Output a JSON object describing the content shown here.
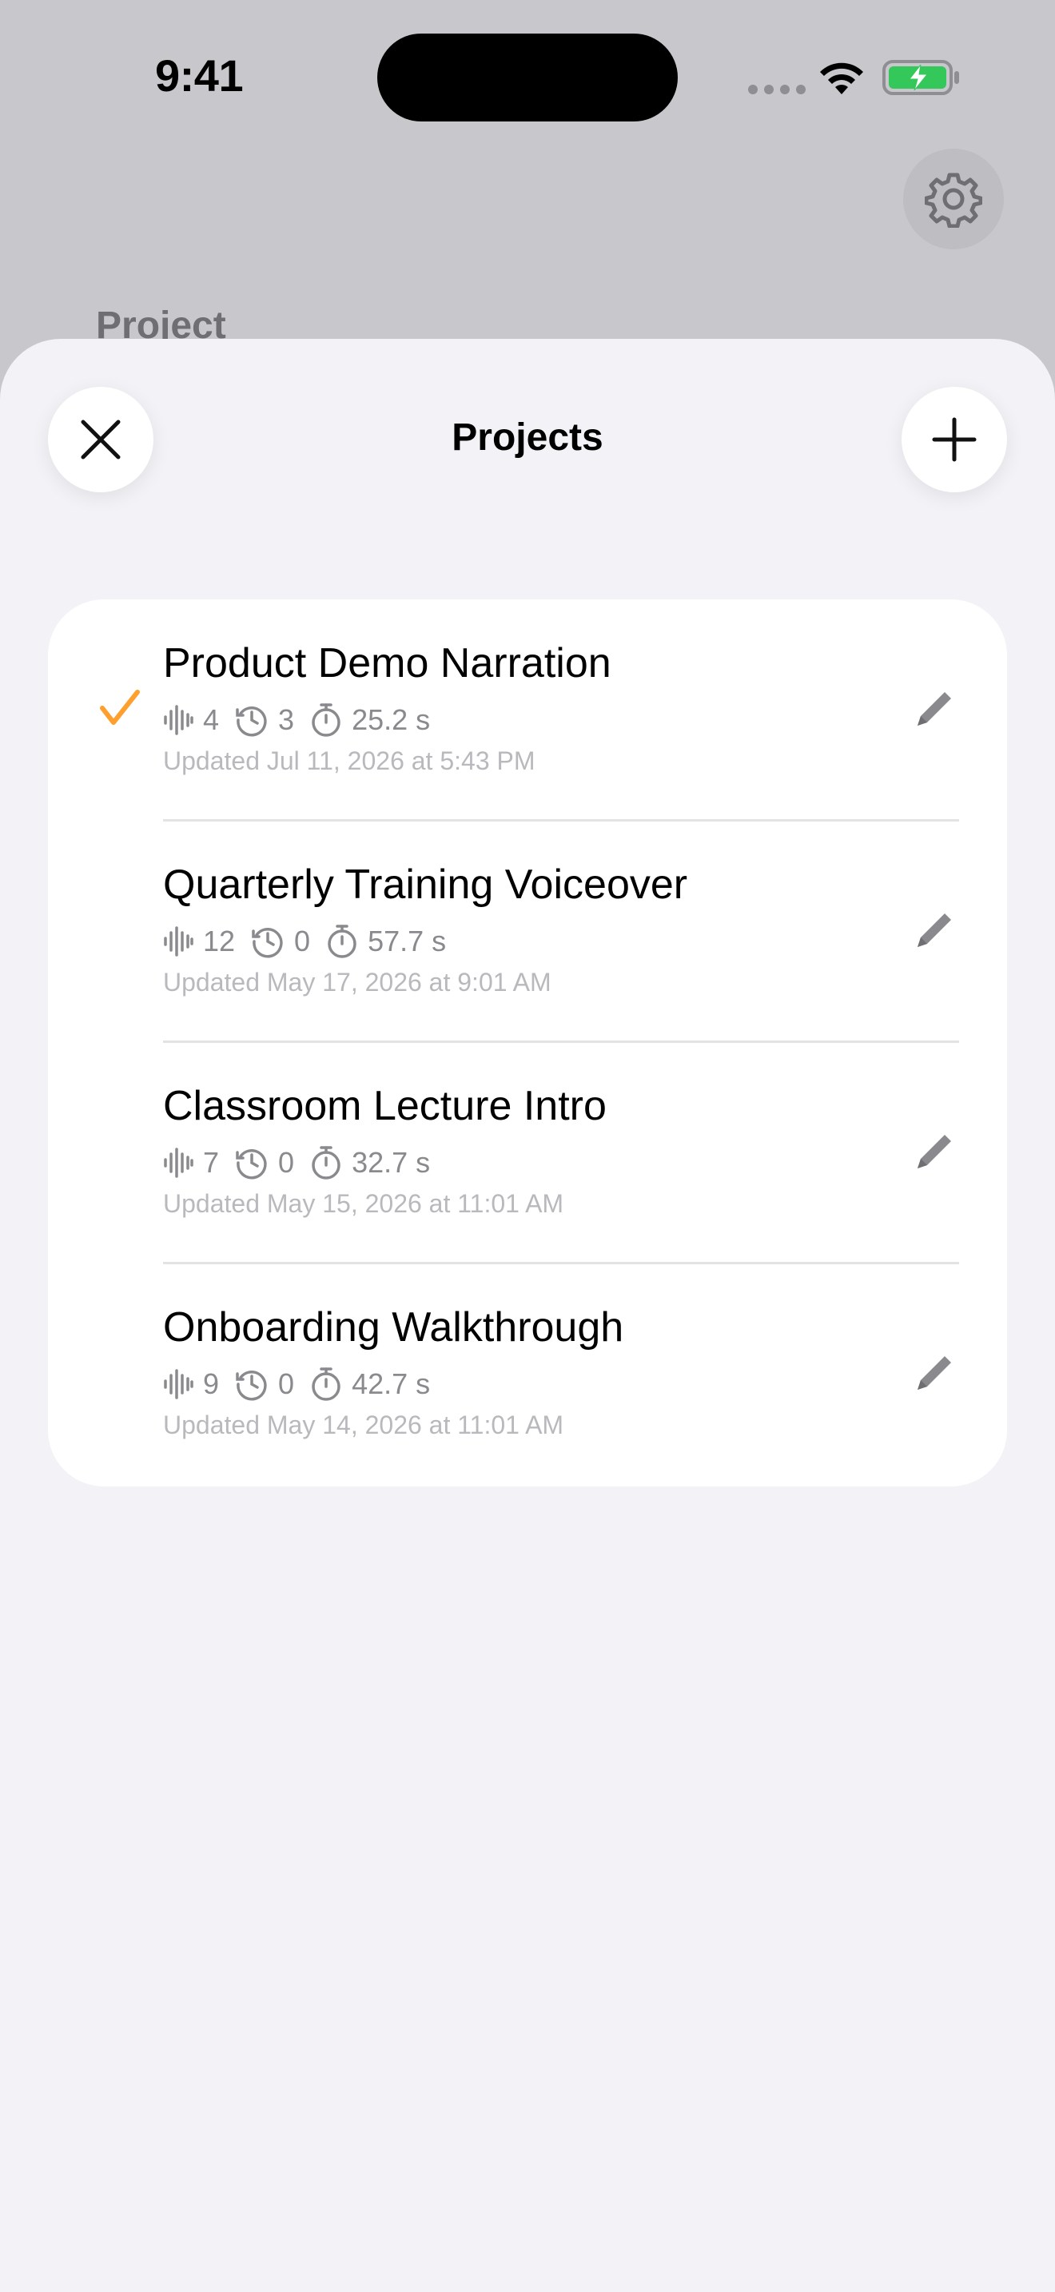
{
  "status_bar": {
    "time": "9:41"
  },
  "background": {
    "title": "Project"
  },
  "sheet": {
    "title": "Projects",
    "accent_color": "#ff9f2e"
  },
  "projects": [
    {
      "name": "Product Demo Narration",
      "clips": "4",
      "versions": "3",
      "duration": "25.2 s",
      "updated": "Updated Jul 11, 2026 at 5:43 PM",
      "selected": true
    },
    {
      "name": "Quarterly Training Voiceover",
      "clips": "12",
      "versions": "0",
      "duration": "57.7 s",
      "updated": "Updated May 17, 2026 at 9:01 AM",
      "selected": false
    },
    {
      "name": "Classroom Lecture Intro",
      "clips": "7",
      "versions": "0",
      "duration": "32.7 s",
      "updated": "Updated May 15, 2026 at 11:01 AM",
      "selected": false
    },
    {
      "name": "Onboarding Walkthrough",
      "clips": "9",
      "versions": "0",
      "duration": "42.7 s",
      "updated": "Updated May 14, 2026 at 11:01 AM",
      "selected": false
    }
  ]
}
